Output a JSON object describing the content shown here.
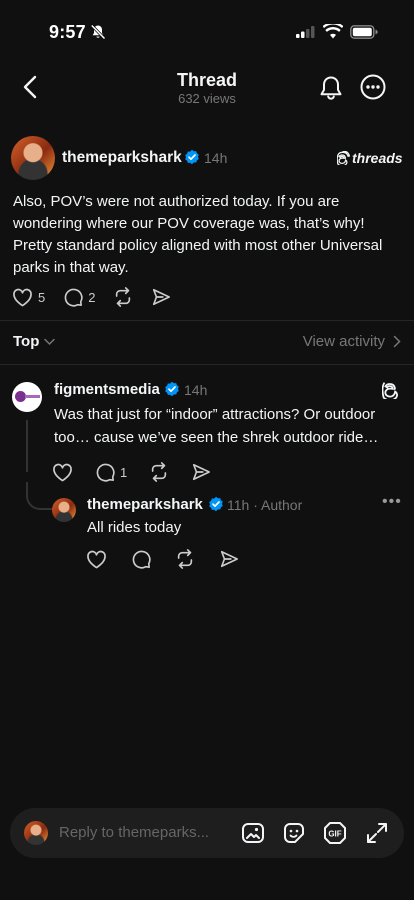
{
  "status_bar": {
    "time": "9:57"
  },
  "header": {
    "title": "Thread",
    "views": "632 views"
  },
  "post": {
    "username": "themeparkshark",
    "time": "14h",
    "brand": "threads",
    "text": "Also, POV’s were not authorized today. If you are wondering where our POV coverage was, that’s why! Pretty standard policy aligned with most other Universal parks in that way.",
    "likes": "5",
    "replies": "2"
  },
  "sort": {
    "label": "Top",
    "view_activity": "View activity"
  },
  "replies": [
    {
      "username": "figmentsmedia",
      "time": "14h",
      "text": "Was that just for “indoor” attractions? Or outdoor too… cause we’ve seen the shrek outdoor ride…",
      "reply_count": "1"
    },
    {
      "username": "themeparkshark",
      "time": "11h · Author",
      "text": "All rides today",
      "more": "•••"
    }
  ],
  "composer": {
    "placeholder": "Reply to themeparks..."
  },
  "colors": {
    "background": "#101010",
    "verified": "#0095f6",
    "muted": "#777777"
  }
}
